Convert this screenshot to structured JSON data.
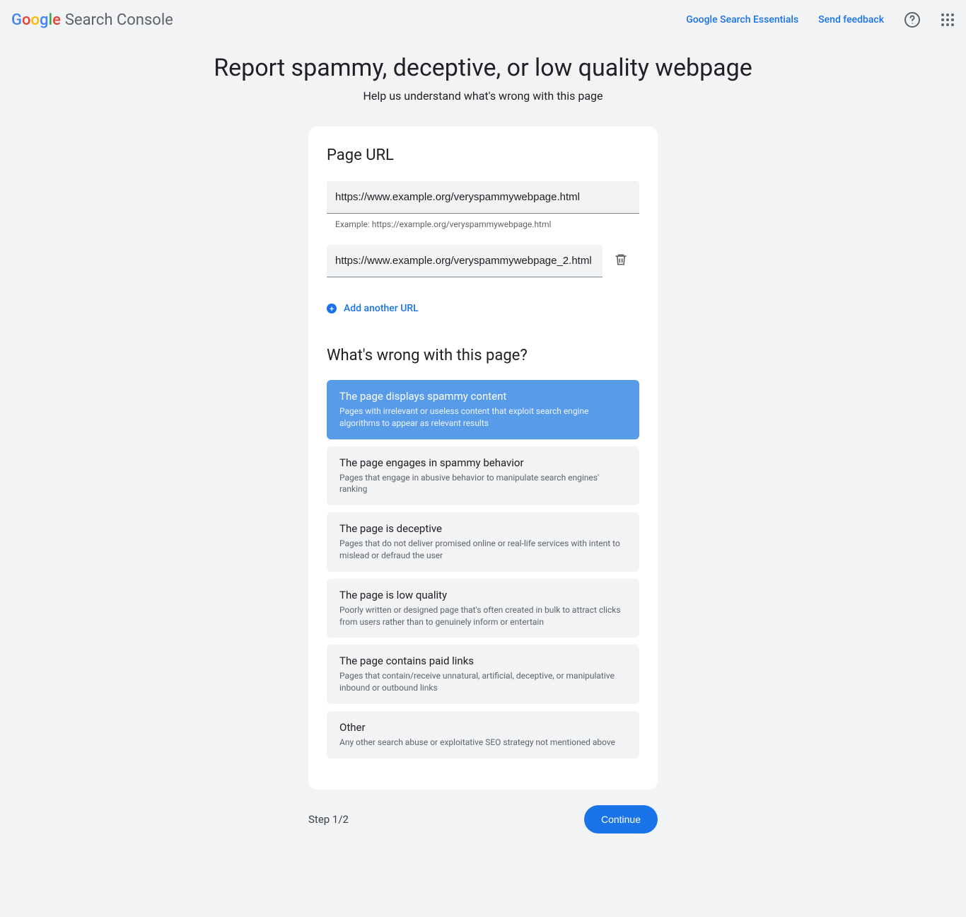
{
  "header": {
    "product_name": "Search Console",
    "links": {
      "essentials": "Google Search Essentials",
      "feedback": "Send feedback"
    }
  },
  "page": {
    "title": "Report spammy, deceptive, or low quality webpage",
    "subtitle": "Help us understand what's wrong with this page"
  },
  "form": {
    "url_section_title": "Page URL",
    "url1_value": "https://www.example.org/veryspammywebpage.html",
    "url1_helper": "Example: https://example.org/veryspammywebpage.html",
    "url2_value": "https://www.example.org/veryspammywebpage_2.html",
    "add_another": "Add another URL",
    "whats_wrong_title": "What's wrong with this page?",
    "options": [
      {
        "title": "The page displays spammy content",
        "desc": "Pages with irrelevant or useless content that exploit search engine algorithms to appear as relevant results",
        "selected": true
      },
      {
        "title": "The page engages in spammy behavior",
        "desc": "Pages that engage in abusive behavior to manipulate search engines' ranking",
        "selected": false
      },
      {
        "title": "The page is deceptive",
        "desc": "Pages that do not deliver promised online or real-life services with intent to mislead or defraud the user",
        "selected": false
      },
      {
        "title": "The page is low quality",
        "desc": "Poorly written or designed page that's often created in bulk to attract clicks from users rather than to genuinely inform or entertain",
        "selected": false
      },
      {
        "title": "The page contains paid links",
        "desc": "Pages that contain/receive unnatural, artificial, deceptive, or manipulative inbound or outbound links",
        "selected": false
      },
      {
        "title": "Other",
        "desc": "Any other search abuse or exploitative SEO strategy not mentioned above",
        "selected": false
      }
    ]
  },
  "footer": {
    "step": "Step 1/2",
    "continue": "Continue"
  }
}
